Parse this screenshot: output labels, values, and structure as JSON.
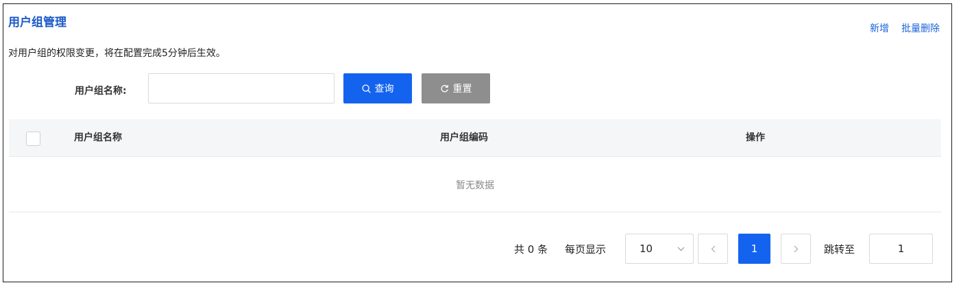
{
  "header": {
    "title": "用户组管理",
    "actions": {
      "add": "新增",
      "batch_delete": "批量删除"
    },
    "notice": "对用户组的权限变更，将在配置完成5分钟后生效。"
  },
  "search": {
    "label": "用户组名称:",
    "value": "",
    "query_label": "查询",
    "reset_label": "重置",
    "query_color": "#1363ef",
    "reset_color": "#8e8e8e"
  },
  "table": {
    "columns": [
      "用户组名称",
      "用户组编码",
      "操作"
    ],
    "rows": [],
    "empty_text": "暂无数据"
  },
  "pagination": {
    "total_text": "共 0 条",
    "per_page_label": "每页显示",
    "page_size": "10",
    "current_page": "1",
    "jump_label": "跳转至",
    "jump_value": "1"
  },
  "icons": {
    "query": "search-icon",
    "reset": "refresh-icon",
    "select": "chevron-down-icon",
    "prev": "chevron-left-icon",
    "next": "chevron-right-icon"
  },
  "colors": {
    "title": "#1b59c7",
    "link": "#1b62d9",
    "primary": "#1363ef"
  }
}
